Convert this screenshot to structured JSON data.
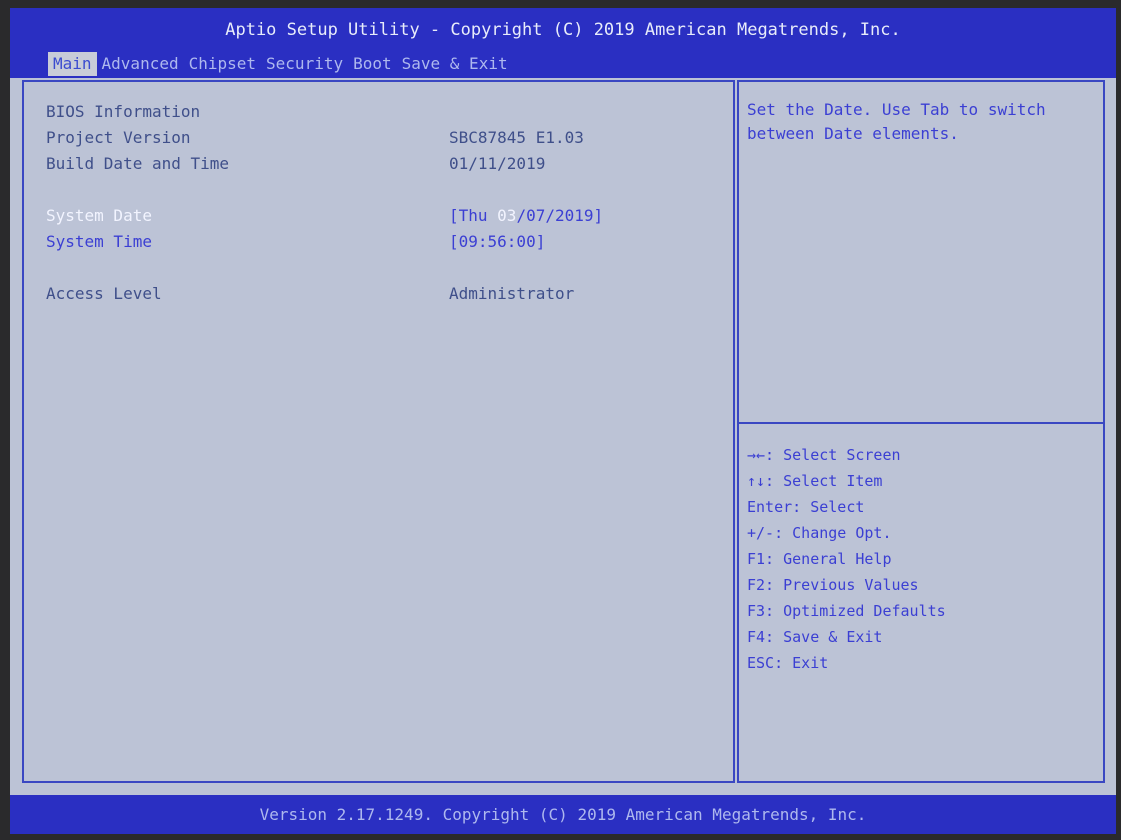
{
  "header": {
    "title": "Aptio Setup Utility - Copyright (C) 2019 American Megatrends, Inc.",
    "tabs": [
      {
        "label": "Main",
        "active": true
      },
      {
        "label": "Advanced"
      },
      {
        "label": "Chipset"
      },
      {
        "label": "Security"
      },
      {
        "label": "Boot"
      },
      {
        "label": "Save & Exit"
      }
    ]
  },
  "main": {
    "bios_info_label": "BIOS Information",
    "project_version_label": "Project Version",
    "project_version_value": "SBC87845 E1.03",
    "build_date_label": "Build Date and Time",
    "build_date_value": "01/11/2019",
    "system_date_label": "System Date",
    "system_date": {
      "prefix": "[Thu ",
      "month": "03",
      "suffix": "/07/2019]"
    },
    "system_time_label": "System Time",
    "system_time_value": "[09:56:00]",
    "access_level_label": "Access Level",
    "access_level_value": "Administrator"
  },
  "help": {
    "text": "Set the Date. Use Tab to switch between Date elements.",
    "keys": [
      "→←: Select Screen",
      "↑↓: Select Item",
      "Enter: Select",
      "+/-: Change Opt.",
      "F1: General Help",
      "F2: Previous Values",
      "F3: Optimized Defaults",
      "F4: Save & Exit",
      "ESC: Exit"
    ]
  },
  "footer": {
    "text": "Version 2.17.1249. Copyright (C) 2019 American Megatrends, Inc."
  },
  "colors": {
    "header_bar": "#2a2fc2",
    "panel_bg": "#bcc3d6",
    "highlight_text": "#f2f4ff",
    "editable_text": "#3b3fd3",
    "static_text": "#3f4f8a"
  }
}
